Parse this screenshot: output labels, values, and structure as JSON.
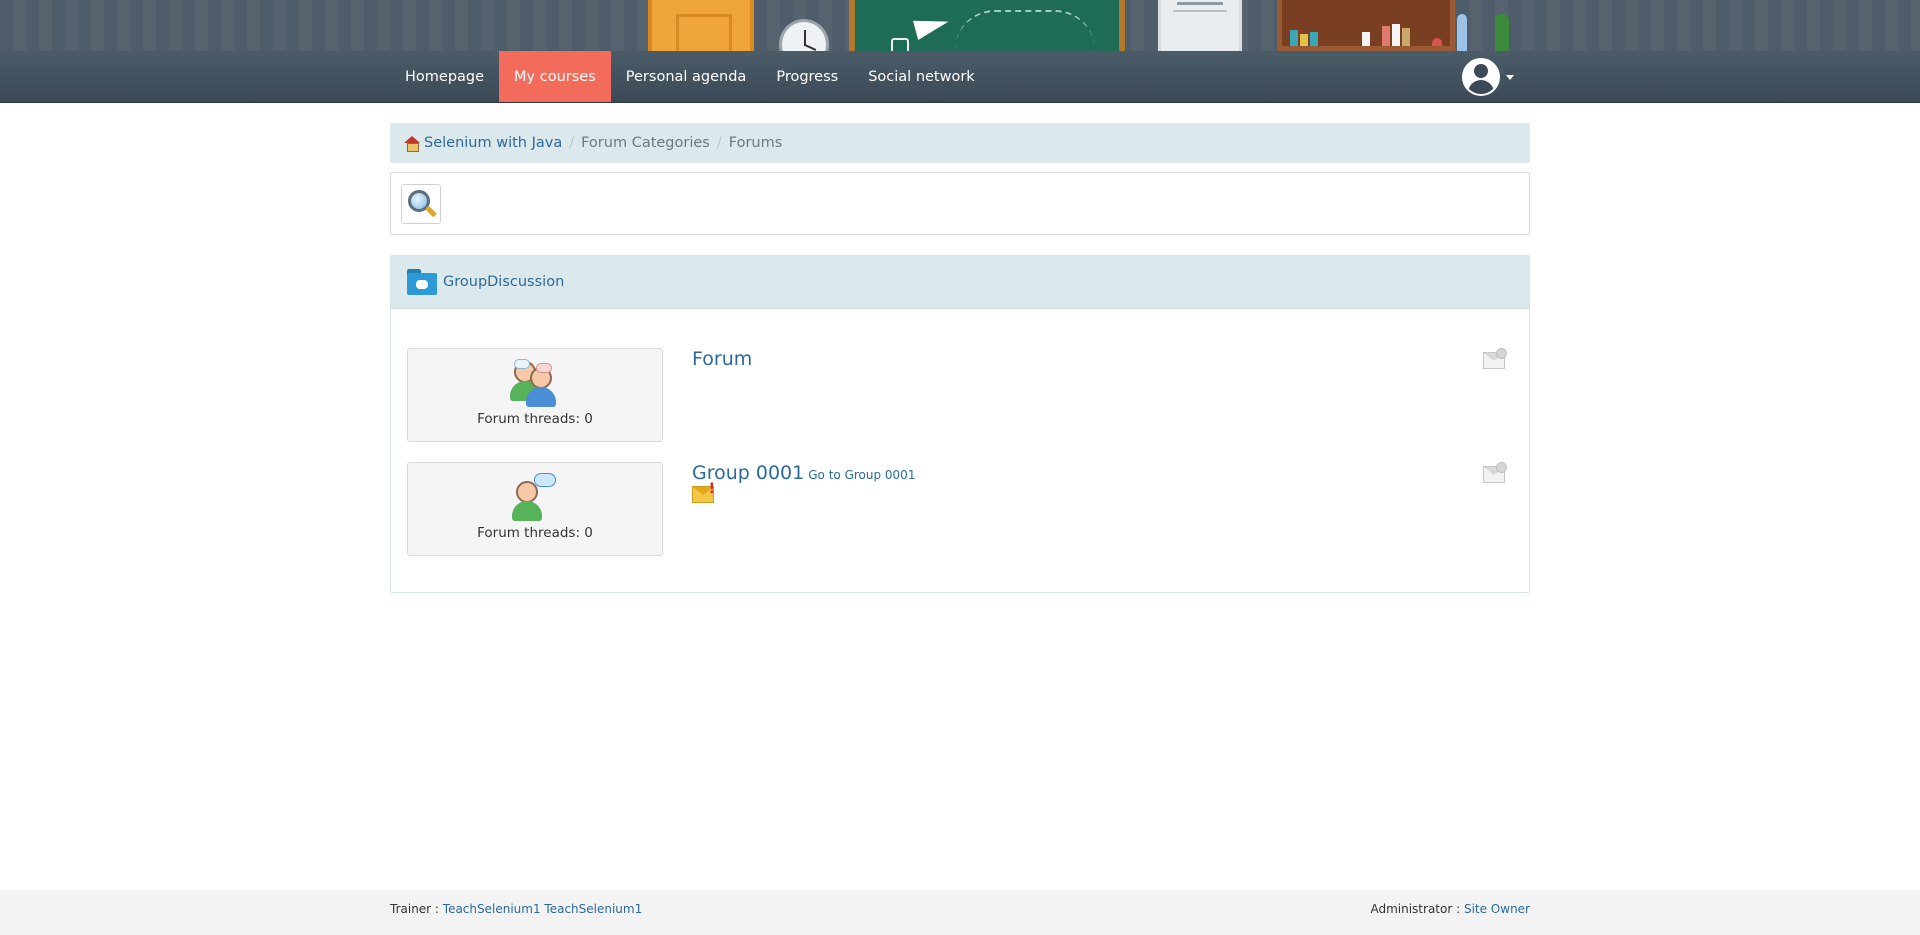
{
  "nav": {
    "items": [
      {
        "label": "Homepage",
        "active": false
      },
      {
        "label": "My courses",
        "active": true
      },
      {
        "label": "Personal agenda",
        "active": false
      },
      {
        "label": "Progress",
        "active": false
      },
      {
        "label": "Social network",
        "active": false
      }
    ],
    "active_color": "#f26b5b",
    "user_icon": "user-avatar-icon"
  },
  "breadcrumb": {
    "home_icon": "home-icon",
    "course": "Selenium with Java",
    "categories": "Forum Categories",
    "forums": "Forums",
    "separator": "/"
  },
  "search": {
    "icon": "magnifier-icon"
  },
  "category": {
    "icon": "folder-chat-icon",
    "title": "GroupDiscussion"
  },
  "forums": [
    {
      "title": "Forum",
      "threads_label": "Forum threads: 0",
      "icon": "group-forum-icon",
      "notify_icon": "notify-envelope-icon"
    },
    {
      "title": "Group 0001",
      "group_link": "Go to Group 0001",
      "threads_label": "Forum threads: 0",
      "icon": "user-chat-icon",
      "alert_icon": "new-mail-alert-icon",
      "notify_icon": "notify-envelope-icon"
    }
  ],
  "footer": {
    "trainer_label": "Trainer : ",
    "trainer_name": "TeachSelenium1 TeachSelenium1",
    "admin_label": "Administrator : ",
    "admin_name": "Site Owner"
  }
}
